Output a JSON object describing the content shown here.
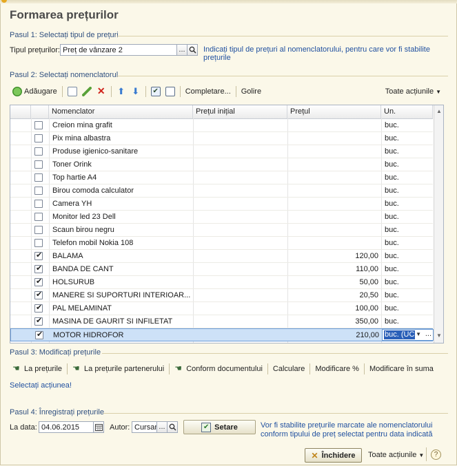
{
  "title": "Formarea prețurilor",
  "step1": {
    "heading": "Pasul 1: Selectați tipul de prețuri",
    "label": "Tipul prețurilor:",
    "value": "Preț de vânzare 2",
    "browse": "...",
    "hint": "Indicați tipul de prețuri al nomenclatorului, pentru care vor fi stabilite prețurile"
  },
  "step2": {
    "heading": "Pasul 2: Selectați nomenclatorul",
    "toolbar": {
      "add": "Adăugare",
      "complete": "Completare...",
      "clear": "Golire",
      "all_actions": "Toate acțiunile"
    },
    "columns": [
      "Nomenclator",
      "Prețul inițial",
      "Prețul",
      "Un."
    ],
    "rows": [
      {
        "name": "Creion mina grafit",
        "checked": false,
        "price": "",
        "unit": "buc."
      },
      {
        "name": "Pix mina albastra",
        "checked": false,
        "price": "",
        "unit": "buc."
      },
      {
        "name": "Produse igienico-sanitare",
        "checked": false,
        "price": "",
        "unit": "buc."
      },
      {
        "name": "Toner Orink",
        "checked": false,
        "price": "",
        "unit": "buc."
      },
      {
        "name": "Top hartie A4",
        "checked": false,
        "price": "",
        "unit": "buc."
      },
      {
        "name": "Birou comoda calculator",
        "checked": false,
        "price": "",
        "unit": "buc."
      },
      {
        "name": "Camera YH",
        "checked": false,
        "price": "",
        "unit": "buc."
      },
      {
        "name": "Monitor led 23 Dell",
        "checked": false,
        "price": "",
        "unit": "buc."
      },
      {
        "name": "Scaun birou negru",
        "checked": false,
        "price": "",
        "unit": "buc."
      },
      {
        "name": "Telefon mobil Nokia 108",
        "checked": false,
        "price": "",
        "unit": "buc."
      },
      {
        "name": "BALAMA",
        "checked": true,
        "price": "120,00",
        "unit": "buc."
      },
      {
        "name": "BANDA DE CANT",
        "checked": true,
        "price": "110,00",
        "unit": "buc."
      },
      {
        "name": "HOLSURUB",
        "checked": true,
        "price": "50,00",
        "unit": "buc."
      },
      {
        "name": "MANERE SI SUPORTURI INTERIOAR...",
        "checked": true,
        "price": "20,50",
        "unit": "buc."
      },
      {
        "name": "PAL MELAMINAT",
        "checked": true,
        "price": "100,00",
        "unit": "buc."
      },
      {
        "name": "MASINA DE GAURIT SI INFILETAT",
        "checked": true,
        "price": "350,00",
        "unit": "buc."
      },
      {
        "name": "MOTOR HIDROFOR",
        "checked": true,
        "price": "210,00",
        "unit": "buc. (UC",
        "selected": true
      }
    ]
  },
  "step3": {
    "heading": "Pasul 3: Modificați prețurile",
    "actions": {
      "to_prices": "La prețurile",
      "to_partner_prices": "La prețurile partenerului",
      "per_document": "Conform documentului",
      "calculate": "Calculare",
      "modify_percent": "Modificare %",
      "modify_sum": "Modificare în suma"
    },
    "select_action": "Selectați acțiunea!"
  },
  "step4": {
    "heading": "Pasul 4: Înregistrați prețurile",
    "date_label": "La data:",
    "date_value": "04.06.2015",
    "author_label": "Autor:",
    "author_value": "Cursar",
    "author_browse": "...",
    "set_button": "Setare",
    "hint": "Vor fi stabilite prețurile marcate ale nomenclatorului conform tipului de preț selectat pentru data indicată"
  },
  "footer": {
    "close": "Închidere",
    "all_actions": "Toate acțiunile",
    "help": "?"
  },
  "colors": {
    "accent": "#2f4f7f",
    "link": "#1f4f9f",
    "selection": "#cde1f7",
    "background": "#fbf8e9"
  }
}
